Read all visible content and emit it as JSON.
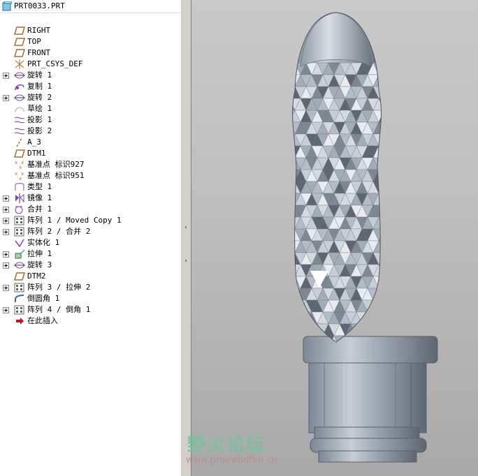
{
  "model_tree": {
    "root": {
      "label": "PRT0033.PRT",
      "icon": "part-icon"
    },
    "items": [
      {
        "label": "RIGHT",
        "icon": "datum-plane-icon",
        "expandable": false
      },
      {
        "label": "TOP",
        "icon": "datum-plane-icon",
        "expandable": false
      },
      {
        "label": "FRONT",
        "icon": "datum-plane-icon",
        "expandable": false
      },
      {
        "label": "PRT_CSYS_DEF",
        "icon": "csys-icon",
        "expandable": false
      },
      {
        "label": "旋转 1",
        "icon": "revolve-icon",
        "expandable": true
      },
      {
        "label": "复制 1",
        "icon": "copy-surface-icon",
        "expandable": false
      },
      {
        "label": "旋转 2",
        "icon": "revolve-icon",
        "expandable": true
      },
      {
        "label": "草绘 1",
        "icon": "sketch-icon",
        "expandable": false
      },
      {
        "label": "投影 1",
        "icon": "projection-icon",
        "expandable": false
      },
      {
        "label": "投影 2",
        "icon": "projection-icon",
        "expandable": false
      },
      {
        "label": "A_3",
        "icon": "datum-axis-icon",
        "expandable": false
      },
      {
        "label": "DTM1",
        "icon": "datum-plane-icon",
        "expandable": false
      },
      {
        "label": "基准点 标识927",
        "icon": "datum-point-icon",
        "expandable": false
      },
      {
        "label": "基准点 标识951",
        "icon": "datum-point-icon",
        "expandable": false
      },
      {
        "label": "类型 1",
        "icon": "type-icon",
        "expandable": false
      },
      {
        "label": "镜像 1",
        "icon": "mirror-icon",
        "expandable": true
      },
      {
        "label": "合并 1",
        "icon": "merge-icon",
        "expandable": true
      },
      {
        "label": "阵列 1 / Moved Copy 1",
        "icon": "pattern-icon",
        "expandable": true
      },
      {
        "label": "阵列 2 / 合并 2",
        "icon": "pattern-icon",
        "expandable": true
      },
      {
        "label": "实体化 1",
        "icon": "solidify-icon",
        "expandable": false
      },
      {
        "label": "拉伸 1",
        "icon": "extrude-icon",
        "expandable": true
      },
      {
        "label": "旋转 3",
        "icon": "revolve-icon",
        "expandable": true
      },
      {
        "label": "DTM2",
        "icon": "datum-plane-icon",
        "expandable": false
      },
      {
        "label": "阵列 3 / 拉伸 2",
        "icon": "pattern-icon",
        "expandable": true
      },
      {
        "label": "倒圆角 1",
        "icon": "round-icon",
        "expandable": false
      },
      {
        "label": "阵列 4 / 倒角 1",
        "icon": "pattern-icon",
        "expandable": true
      },
      {
        "label": "在此插入",
        "icon": "insert-here-arrow-icon",
        "expandable": false
      }
    ]
  },
  "splitter": {
    "collapse_glyph": "‹",
    "expand_glyph": "›"
  },
  "watermark": {
    "text": "野火论坛",
    "url": "www.proewildfire.cn"
  },
  "colors": {
    "tree_bg": "#ffffff",
    "viewport_bg": "#c4c4c4",
    "model": "#a7b1bc",
    "icon_purple": "#8a3fb5",
    "insert_arrow": "#cc1111"
  }
}
